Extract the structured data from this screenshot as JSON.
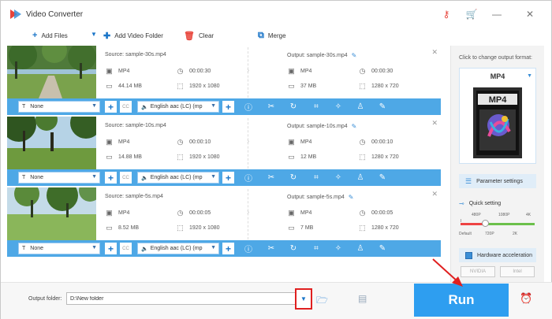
{
  "app": {
    "title": "Video Converter"
  },
  "toolbar": {
    "add_files": "Add Files",
    "add_folder": "Add Video Folder",
    "clear": "Clear",
    "merge": "Merge"
  },
  "files": [
    {
      "source": "Source: sample-30s.mp4",
      "output": "Output: sample-30s.mp4",
      "src_format": "MP4",
      "src_duration": "00:00:30",
      "src_size": "44.14 MB",
      "src_res": "1920 x 1080",
      "out_format": "MP4",
      "out_duration": "00:00:30",
      "out_size": "37 MB",
      "out_res": "1280 x 720",
      "subtitle": "None",
      "audio": "English aac (LC) (mp"
    },
    {
      "source": "Source: sample-10s.mp4",
      "output": "Output: sample-10s.mp4",
      "src_format": "MP4",
      "src_duration": "00:00:10",
      "src_size": "14.88 MB",
      "src_res": "1920 x 1080",
      "out_format": "MP4",
      "out_duration": "00:00:10",
      "out_size": "12 MB",
      "out_res": "1280 x 720",
      "subtitle": "None",
      "audio": "English aac (LC) (mp"
    },
    {
      "source": "Source: sample-5s.mp4",
      "output": "Output: sample-5s.mp4",
      "src_format": "MP4",
      "src_duration": "00:00:05",
      "src_size": "8.52 MB",
      "src_res": "1920 x 1080",
      "out_format": "MP4",
      "out_duration": "00:00:05",
      "out_size": "7 MB",
      "out_res": "1280 x 720",
      "subtitle": "None",
      "audio": "English aac (LC) (mp"
    }
  ],
  "panel": {
    "hint": "Click to change output format:",
    "format": "MP4",
    "format_icon_text": "MP4",
    "parameter_settings": "Parameter settings",
    "quick_setting": "Quick setting",
    "slider_top": [
      "480P",
      "1080P",
      "4K"
    ],
    "slider_bottom": [
      "Default",
      "720P",
      "2K"
    ],
    "quality_level": 0.33,
    "hw_accel": "Hardware acceleration",
    "nvidia": "NVIDIA",
    "intel": "Intel"
  },
  "bottom": {
    "output_folder_label": "Output folder:",
    "output_folder_value": "D:\\New folder",
    "run": "Run"
  },
  "colors": {
    "accent": "#2e9ef0",
    "editbar": "#4ea8e6",
    "highlight": "#e02020"
  }
}
